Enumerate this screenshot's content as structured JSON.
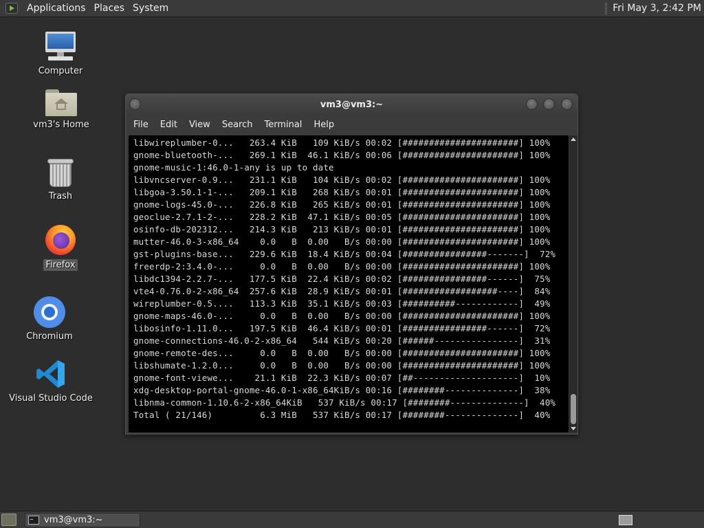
{
  "top_panel": {
    "menus": [
      "Applications",
      "Places",
      "System"
    ],
    "clock": "Fri May  3,  2:42 PM"
  },
  "desktop_icons": {
    "computer": "Computer",
    "home": "vm3's Home",
    "trash": "Trash",
    "firefox": "Firefox",
    "chromium": "Chromium",
    "vscode": "Visual Studio Code"
  },
  "terminal": {
    "title": "vm3@vm3:~",
    "menu": [
      "File",
      "Edit",
      "View",
      "Search",
      "Terminal",
      "Help"
    ],
    "lines": [
      "libwireplumber-0...   263.4 KiB   109 KiB/s 00:02 [######################] 100%",
      "gnome-bluetooth-...   269.1 KiB  46.1 KiB/s 00:06 [######################] 100%",
      "gnome-music-1:46.0-1-any is up to date",
      "libvncserver-0.9...   231.1 KiB   104 KiB/s 00:02 [######################] 100%",
      "libgoa-3.50.1-1-...   209.1 KiB   268 KiB/s 00:01 [######################] 100%",
      "gnome-logs-45.0-...   226.8 KiB   265 KiB/s 00:01 [######################] 100%",
      "geoclue-2.7.1-2-...   228.2 KiB  47.1 KiB/s 00:05 [######################] 100%",
      "osinfo-db-202312...   214.3 KiB   213 KiB/s 00:01 [######################] 100%",
      "mutter-46.0-3-x86_64    0.0   B  0.00   B/s 00:00 [######################] 100%",
      "gst-plugins-base...   229.6 KiB  18.4 KiB/s 00:04 [################-------]  72%",
      "freerdp-2:3.4.0-...     0.0   B  0.00   B/s 00:00 [######################] 100%",
      "libdc1394-2.2.7-...   177.5 KiB  22.4 KiB/s 00:02 [################------]  75%",
      "vte4-0.76.0-2-x86_64  257.6 KiB  28.9 KiB/s 00:01 [##################----]  84%",
      "wireplumber-0.5....   113.3 KiB  35.1 KiB/s 00:03 [##########------------]  49%",
      "gnome-maps-46.0-...     0.0   B  0.00   B/s 00:00 [######################] 100%",
      "libosinfo-1.11.0...   197.5 KiB  46.4 KiB/s 00:01 [################------]  72%",
      "gnome-connections-46.0-2-x86_64   544 KiB/s 00:20 [######----------------]  31%",
      "gnome-remote-des...     0.0   B  0.00   B/s 00:00 [######################] 100%",
      "libshumate-1.2.0...     0.0   B  0.00   B/s 00:00 [######################] 100%",
      "gnome-font-viewe...    21.1 KiB  22.3 KiB/s 00:07 [##--------------------]  10%",
      "xdg-desktop-portal-gnome-46.0-1-x86_64KiB/s 00:16 [########--------------]  38%",
      "libnma-common-1.10.6-2-x86_64KiB   537 KiB/s 00:17 [########--------------]  40%",
      "Total ( 21/146)         6.3 MiB   537 KiB/s 00:17 [########--------------]  40%"
    ]
  },
  "bottom_panel": {
    "task_label": "vm3@vm3:~"
  },
  "colors": {
    "desktop_bg": "#2d2d2d",
    "panel_bg": "#3a3a3a",
    "terminal_bg": "#000000",
    "terminal_fg": "#d9d9d9"
  }
}
